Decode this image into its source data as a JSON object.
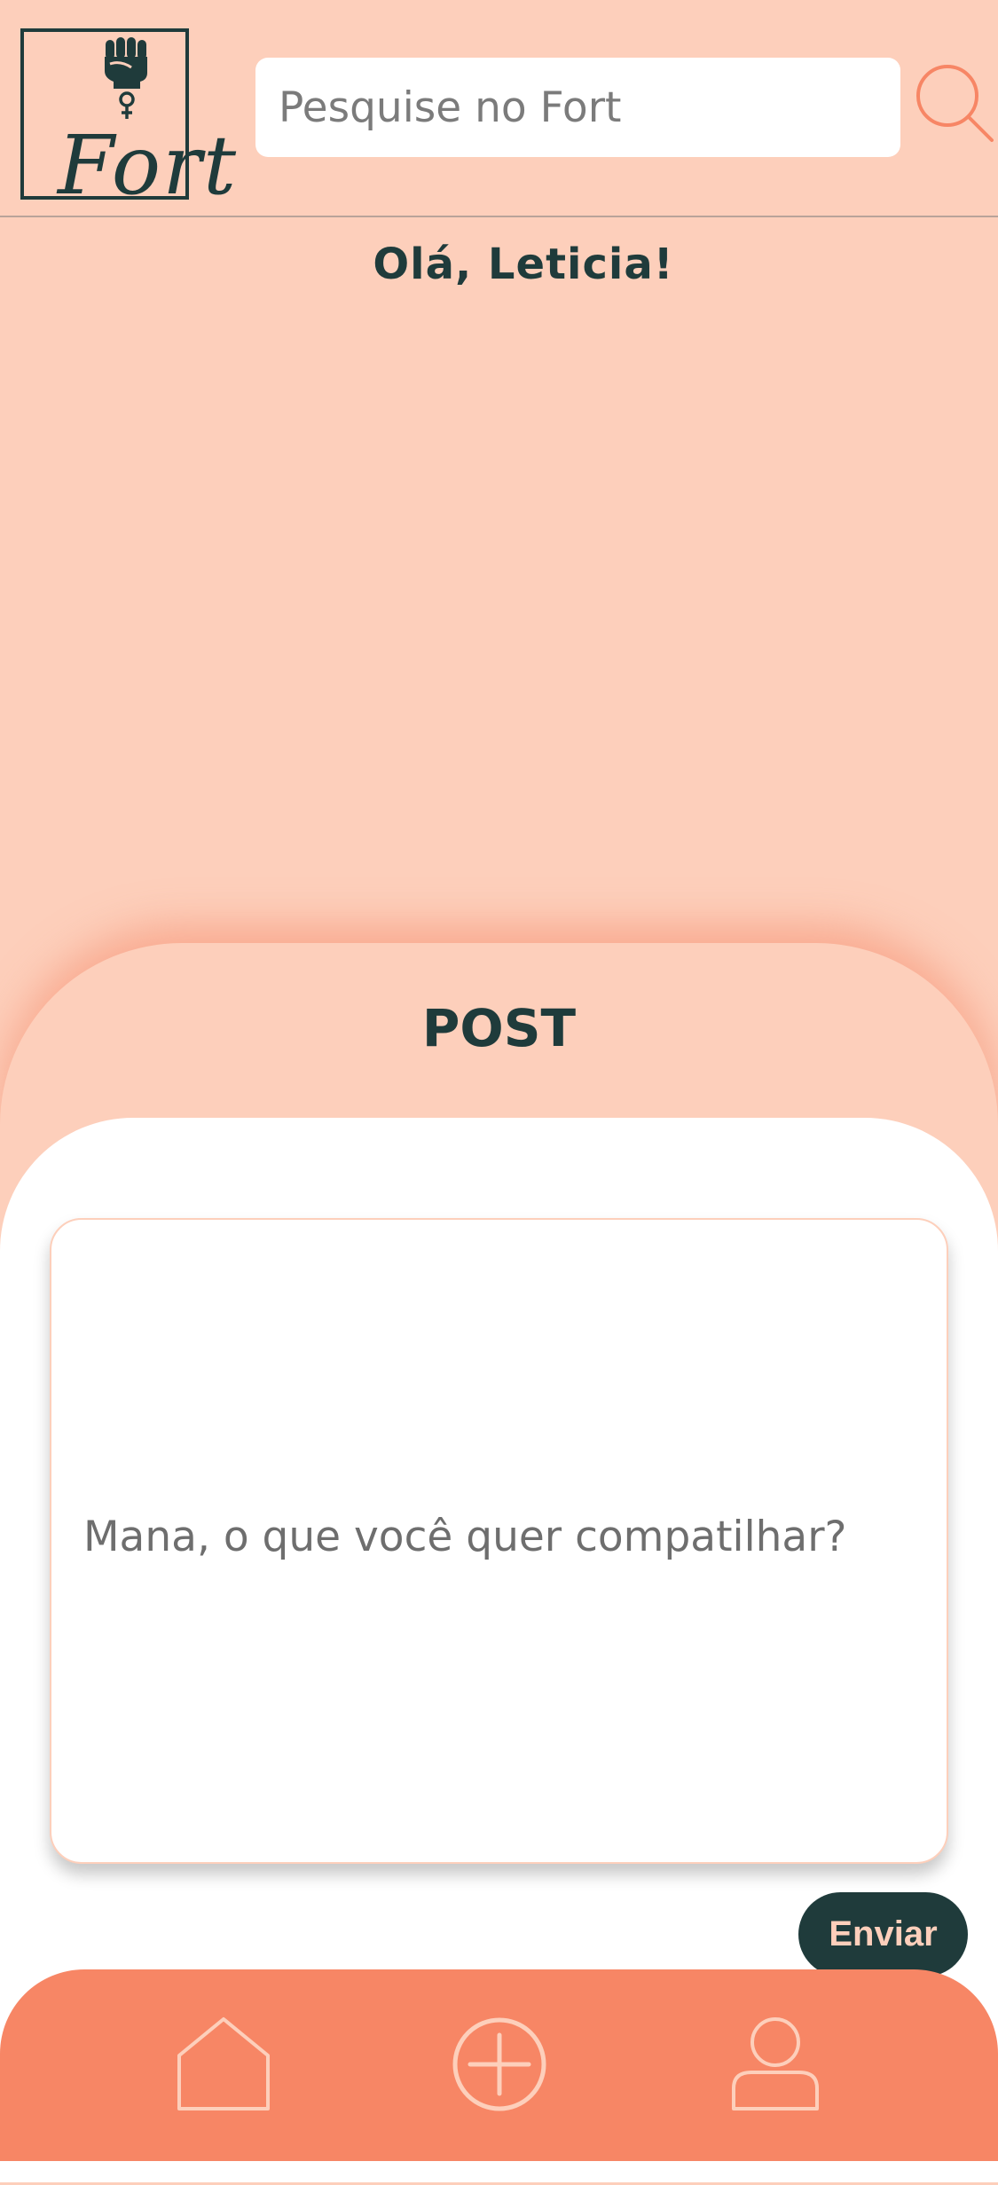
{
  "header": {
    "logo_text": "Fort",
    "search": {
      "placeholder": "Pesquise no Fort",
      "value": "",
      "icon": "search-icon"
    }
  },
  "main": {
    "greeting": "Olá, Leticia!"
  },
  "post": {
    "title": "POST",
    "placeholder": "Mana, o que você quer compatilhar?",
    "value": "",
    "submit_label": "Enviar"
  },
  "bottom_nav": {
    "items": [
      {
        "icon": "home-icon"
      },
      {
        "icon": "plus-circle-icon"
      },
      {
        "icon": "user-icon"
      }
    ]
  },
  "colors": {
    "background": "#FDCFBB",
    "dark": "#1F3B3B",
    "accent": "#F78665",
    "surface": "#FFFFFF"
  }
}
